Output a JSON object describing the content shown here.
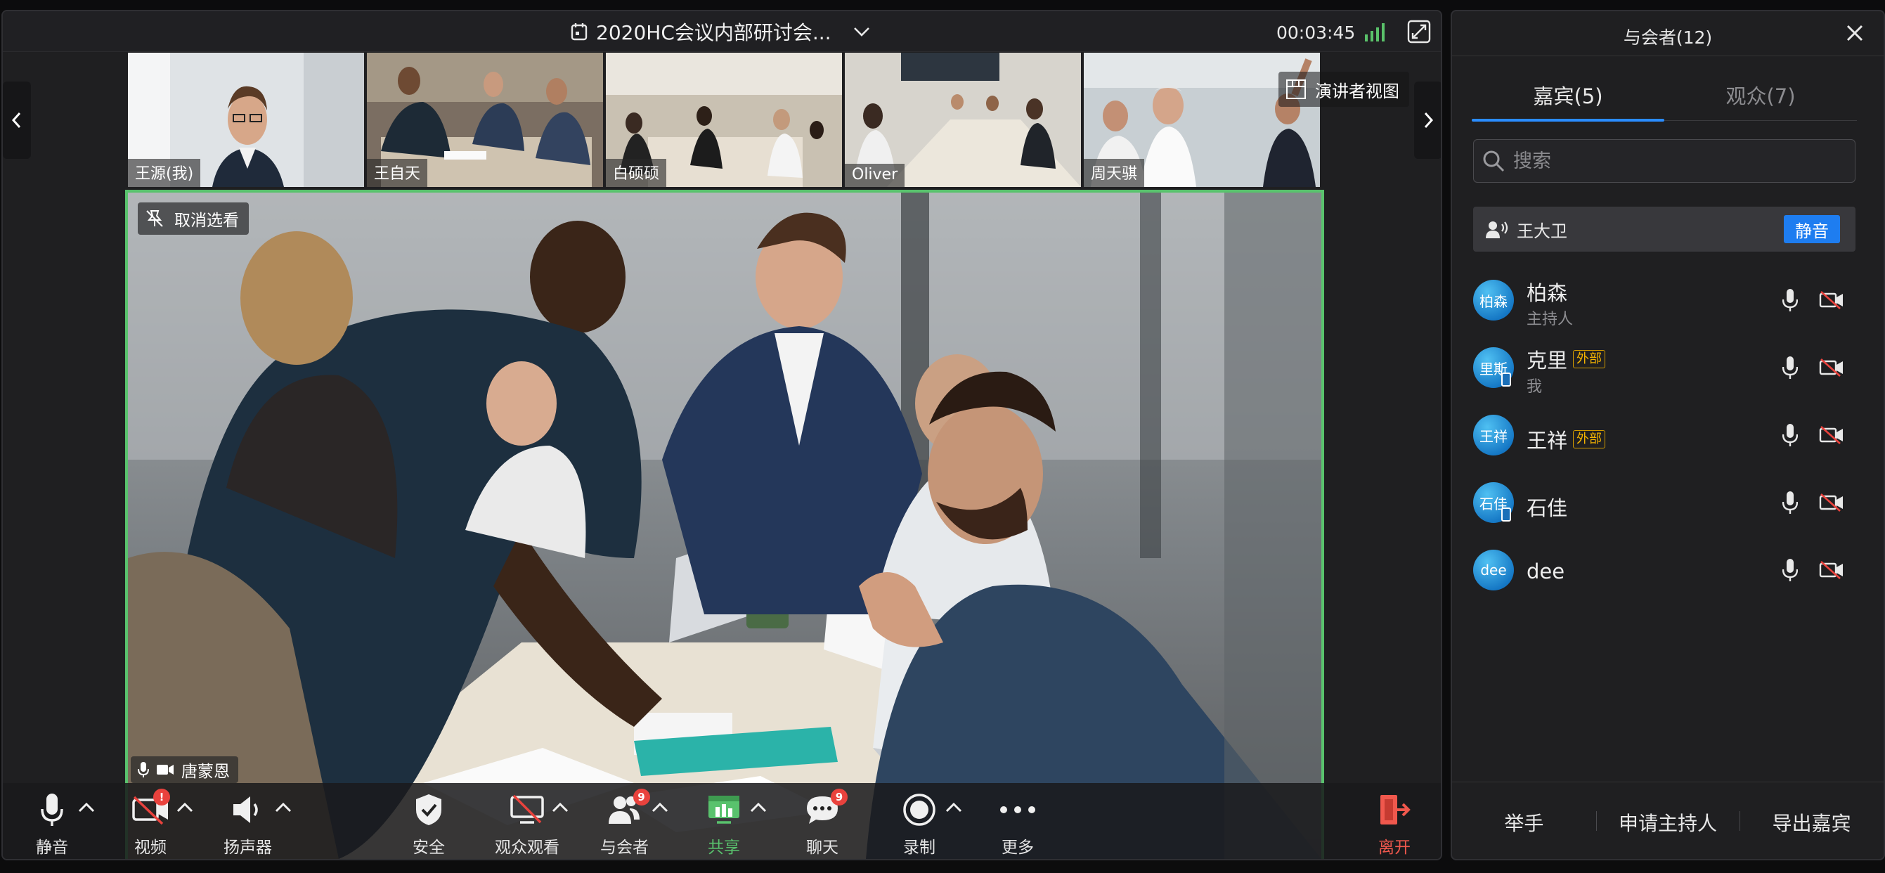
{
  "meeting": {
    "title": "2020HC会议内部研讨会...",
    "timer": "00:03:45",
    "presenter_view_label": "演讲者视图",
    "thumbnails": [
      {
        "name": "王源(我)"
      },
      {
        "name": "王自天"
      },
      {
        "name": "白硕硕"
      },
      {
        "name": "Oliver"
      },
      {
        "name": "周天骐"
      }
    ],
    "main_video": {
      "cancel_select_label": "取消选看",
      "speaker_name": "唐蒙恩"
    },
    "toolbar": {
      "mute": "静音",
      "video": "视频",
      "video_badge": "!",
      "speaker": "扬声器",
      "security": "安全",
      "audience_view": "观众观看",
      "participants": "与会者",
      "participants_badge": "9",
      "share": "共享",
      "chat": "聊天",
      "chat_badge": "9",
      "record": "录制",
      "more": "更多",
      "leave": "离开"
    }
  },
  "panel": {
    "title": "与会者(12)",
    "tabs": [
      {
        "label": "嘉宾(5)",
        "active": true
      },
      {
        "label": "观众(7)",
        "active": false
      }
    ],
    "search_placeholder": "搜索",
    "speaking": {
      "name": "王大卫",
      "mute_label": "静音"
    },
    "participants": [
      {
        "avatar": "柏森",
        "name": "柏森",
        "tag": "",
        "role": "主持人"
      },
      {
        "avatar": "里斯",
        "name": "克里",
        "tag": "外部",
        "role": "我"
      },
      {
        "avatar": "王祥",
        "name": "王祥",
        "tag": "外部",
        "role": ""
      },
      {
        "avatar": "石佳",
        "name": "石佳",
        "tag": "",
        "role": ""
      },
      {
        "avatar": "dee",
        "name": "dee",
        "tag": "",
        "role": ""
      }
    ],
    "footer": {
      "raise_hand": "举手",
      "request_host": "申请主持人",
      "export_guests": "导出嘉宾"
    }
  },
  "colors": {
    "accent_blue": "#1e7df0",
    "active_speaker_border": "#59c26d",
    "share_green": "#59c26d",
    "leave_red": "#f0584d",
    "external_tag": "#f5b400"
  }
}
